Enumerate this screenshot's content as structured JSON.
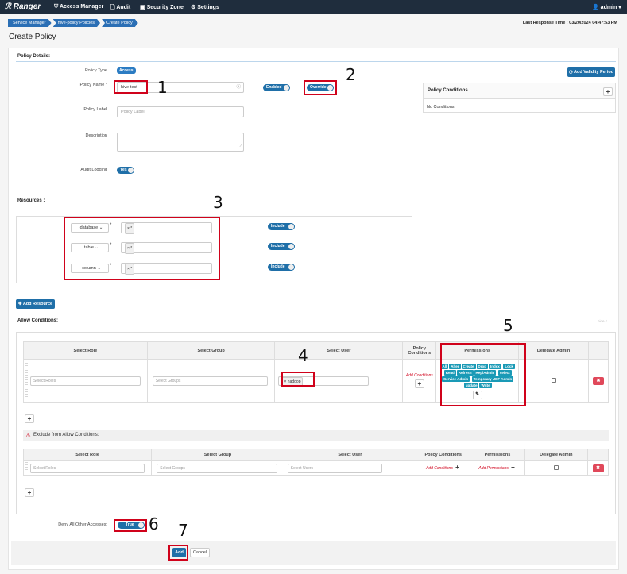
{
  "app": {
    "logo": "Ranger"
  },
  "nav": {
    "items": [
      {
        "label": "Access Manager",
        "icon": "shield-icon"
      },
      {
        "label": "Audit",
        "icon": "file-icon"
      },
      {
        "label": "Security Zone",
        "icon": "zone-icon"
      },
      {
        "label": "Settings",
        "icon": "gear-icon"
      }
    ],
    "user": "admin"
  },
  "breadcrumb": [
    "Service Manager",
    "hive-policy Policies",
    "Create Policy"
  ],
  "response_time": "Last Response Time : 03/20/2024 04:47:53 PM",
  "page_title": "Create Policy",
  "policy_details": {
    "heading": "Policy Details:",
    "policy_type_label": "Policy Type",
    "policy_type_value": "Access",
    "policy_name_label": "Policy Name *",
    "policy_name_value": "hive-test",
    "enabled_label": "Enabled",
    "override_label": "Override",
    "policy_label_label": "Policy Label",
    "policy_label_placeholder": "Policy Label",
    "description_label": "Description",
    "audit_logging_label": "Audit Logging",
    "audit_logging_value": "Yes",
    "add_validity_label": "Add Validity Period",
    "conditions_heading": "Policy Conditions",
    "conditions_empty": "No Conditions"
  },
  "resources": {
    "heading": "Resources :",
    "rows": [
      {
        "type": "database",
        "include": "Include"
      },
      {
        "type": "table",
        "include": "Include"
      },
      {
        "type": "column",
        "include": "Include"
      }
    ],
    "value_tag": "× *",
    "add_resource_label": "Add Resource"
  },
  "allow": {
    "heading": "Allow Conditions:",
    "hide_label": "hide ^",
    "columns": [
      "Select Role",
      "Select Group",
      "Select User",
      "Policy Conditions",
      "Permissions",
      "Delegate Admin"
    ],
    "role_placeholder": "Select Roles",
    "group_placeholder": "Select Groups",
    "user_tag": "× hadoop",
    "add_conditions": "Add Conditions",
    "permissions": [
      "All",
      "Alter",
      "Create",
      "Drop",
      "Index",
      "Lock",
      "Read",
      "Refresh",
      "ReplAdmin",
      "select",
      "Service Admin",
      "Temporary UDF Admin",
      "update",
      "Write"
    ]
  },
  "exclude": {
    "heading": "Exclude from Allow Conditions:",
    "columns": [
      "Select Role",
      "Select Group",
      "Select User",
      "Policy Conditions",
      "Permissions",
      "Delegate Admin"
    ],
    "role_placeholder": "Select Roles",
    "group_placeholder": "Select Groups",
    "user_placeholder": "Select Users",
    "add_conditions": "Add Conditions",
    "add_permissions": "Add Permissions"
  },
  "deny": {
    "label": "Deny All Other Accesses:",
    "value": "True"
  },
  "footer": {
    "add_label": "Add",
    "cancel_label": "Cancel"
  },
  "annotations": [
    "1",
    "2",
    "3",
    "4",
    "5",
    "6",
    "7"
  ],
  "colors": {
    "topbar": "#1f2d3d",
    "accent": "#1f6fa8",
    "highlight": "#d0021b",
    "perm_tag": "#1a9ab6"
  }
}
